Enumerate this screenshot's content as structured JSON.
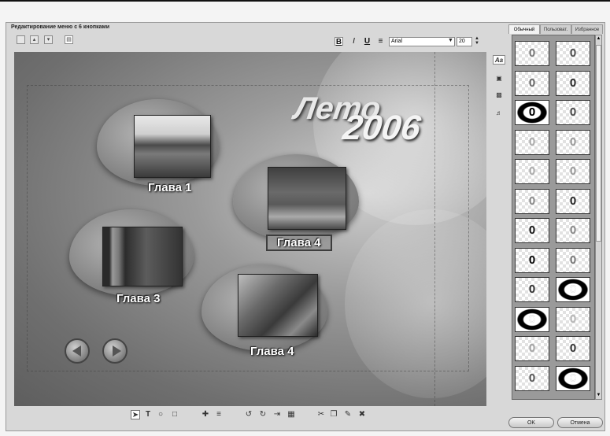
{
  "window": {
    "title": "Редактирование меню с 6 кнопками"
  },
  "toolbar": {
    "buttons": [
      "blank-icon",
      "move-up-icon",
      "move-down-icon",
      "layout-icon"
    ],
    "format": {
      "bold": "B",
      "italic": "I",
      "underline": "U",
      "align": "≡"
    },
    "font": "Arial",
    "font_size": "20"
  },
  "canvas": {
    "title_line1": "Лето",
    "title_line2": "2006",
    "buttons": [
      {
        "label": "Глава 1"
      },
      {
        "label": "Глава 4"
      },
      {
        "label": "Глава 3"
      },
      {
        "label": "Глава 4"
      }
    ],
    "nav": {
      "prev": "back-arrow-icon",
      "next": "forward-arrow-icon"
    }
  },
  "side_tools": {
    "text_style": "Aa"
  },
  "right_panel": {
    "tabs": [
      {
        "label": "Обычный",
        "active": true
      },
      {
        "label": "Пользоват.",
        "active": false
      },
      {
        "label": "Избранное",
        "active": false
      }
    ],
    "thumbnail_glyph": "0"
  },
  "bottom_toolbar": {
    "tools": [
      "select-arrow-icon",
      "text-tool-icon",
      "ellipse-tool-icon",
      "rectangle-tool-icon",
      "move-icon",
      "align-center-icon",
      "rotate-left-icon",
      "rotate-right-icon",
      "align-right-icon",
      "grid-icon",
      "cut-icon",
      "copy-icon",
      "paste-icon",
      "delete-icon"
    ]
  },
  "dialog_buttons": {
    "ok": "OK",
    "cancel": "Отмена"
  }
}
